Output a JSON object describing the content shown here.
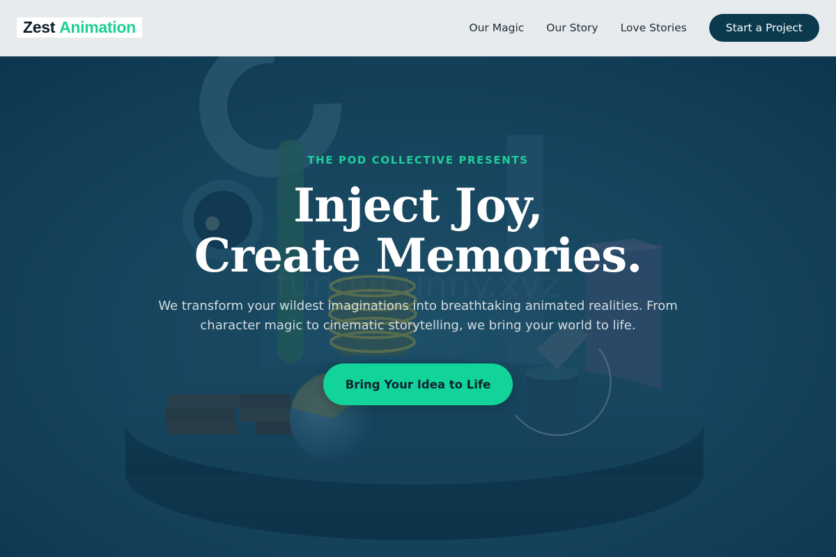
{
  "brand": {
    "name_part1": "Zest",
    "name_part2": "Animation"
  },
  "nav": {
    "links": [
      "Our Magic",
      "Our Story",
      "Love Stories"
    ],
    "cta_label": "Start a Project"
  },
  "hero": {
    "eyebrow": "THE POD COLLECTIVE PRESENTS",
    "headline_line1": "Inject Joy,",
    "headline_line2": "Create Memories.",
    "subtext": "We transform your wildest imaginations into breathtaking animated realities. From character magic to cinematic storytelling, we bring your world to life.",
    "cta_label": "Bring Your Idea to Life"
  },
  "colors": {
    "header_bg": "#e8ebed",
    "brand_dark": "#0d1b24",
    "accent_green": "#1ccf96",
    "nav_button_bg": "#0b3a4e",
    "hero_overlay": "#0f3b52",
    "hero_cta_bg": "#12d49a"
  }
}
